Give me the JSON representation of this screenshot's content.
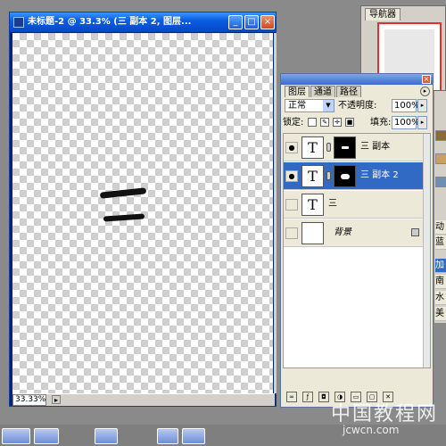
{
  "document": {
    "title": "未标题-2 @ 33.3% (三 副本 2, 图层...",
    "zoom": "33.33%"
  },
  "navigator": {
    "tab_label": "导航器"
  },
  "layers_panel": {
    "tabs": [
      {
        "label": "图层",
        "active": true
      },
      {
        "label": "通道",
        "active": false
      },
      {
        "label": "路径",
        "active": false
      }
    ],
    "blend_mode": "正常",
    "opacity_label": "不透明度:",
    "opacity_value": "100%",
    "lock_label": "锁定:",
    "fill_label": "填充:",
    "fill_value": "100%",
    "layers": [
      {
        "name": "三 副本",
        "visible": true,
        "selected": false,
        "type": "text",
        "has_mask": true
      },
      {
        "name": "三 副本 2",
        "visible": true,
        "selected": true,
        "type": "text",
        "has_mask": true
      },
      {
        "name": "三",
        "visible": false,
        "selected": false,
        "type": "text",
        "has_mask": false
      },
      {
        "name": "背景",
        "visible": false,
        "selected": false,
        "type": "background",
        "has_mask": false,
        "locked": true
      }
    ]
  },
  "right_panel": {
    "items": [
      "动",
      "蓝",
      "加",
      "南",
      "水",
      "美"
    ]
  },
  "watermark": {
    "main": "中国教程网",
    "url": "jcwcn.com"
  },
  "colors": {
    "selection": "#316ac5",
    "title_bar": "#0a5ee0",
    "panel_bg": "#ece9d8",
    "workspace": "#8a8a8a"
  }
}
